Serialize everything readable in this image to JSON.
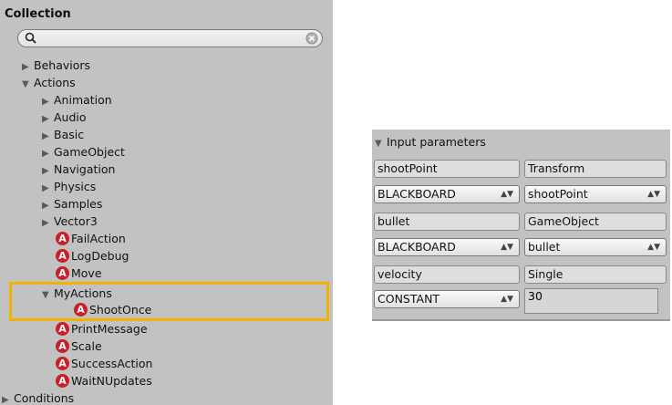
{
  "collection": {
    "title": "Collection",
    "search": {
      "value": "",
      "placeholder": ""
    },
    "tree": [
      {
        "label": "Behaviors",
        "kind": "collapsed"
      },
      {
        "label": "Actions",
        "kind": "expanded"
      },
      {
        "label": "Animation",
        "kind": "collapsed"
      },
      {
        "label": "Audio",
        "kind": "collapsed"
      },
      {
        "label": "Basic",
        "kind": "collapsed"
      },
      {
        "label": "GameObject",
        "kind": "collapsed"
      },
      {
        "label": "Navigation",
        "kind": "collapsed"
      },
      {
        "label": "Physics",
        "kind": "collapsed"
      },
      {
        "label": "Samples",
        "kind": "collapsed"
      },
      {
        "label": "Vector3",
        "kind": "collapsed"
      },
      {
        "label": "FailAction",
        "kind": "action"
      },
      {
        "label": "LogDebug",
        "kind": "action"
      },
      {
        "label": "Move",
        "kind": "action"
      },
      {
        "label": "MyActions",
        "kind": "expanded"
      },
      {
        "label": "ShootOnce",
        "kind": "action"
      },
      {
        "label": "PrintMessage",
        "kind": "action"
      },
      {
        "label": "Scale",
        "kind": "action"
      },
      {
        "label": "SuccessAction",
        "kind": "action"
      },
      {
        "label": "WaitNUpdates",
        "kind": "action"
      },
      {
        "label": "Conditions",
        "kind": "collapsed"
      }
    ],
    "action_badge": "A",
    "highlight_color": "#f0b400"
  },
  "params": {
    "header": "Input parameters",
    "rows": [
      {
        "name": "shootPoint",
        "type": "Transform",
        "source": "BLACKBOARD",
        "value": "shootPoint"
      },
      {
        "name": "bullet",
        "type": "GameObject",
        "source": "BLACKBOARD",
        "value": "bullet"
      },
      {
        "name": "velocity",
        "type": "Single",
        "source": "CONSTANT",
        "value": "30"
      }
    ]
  }
}
